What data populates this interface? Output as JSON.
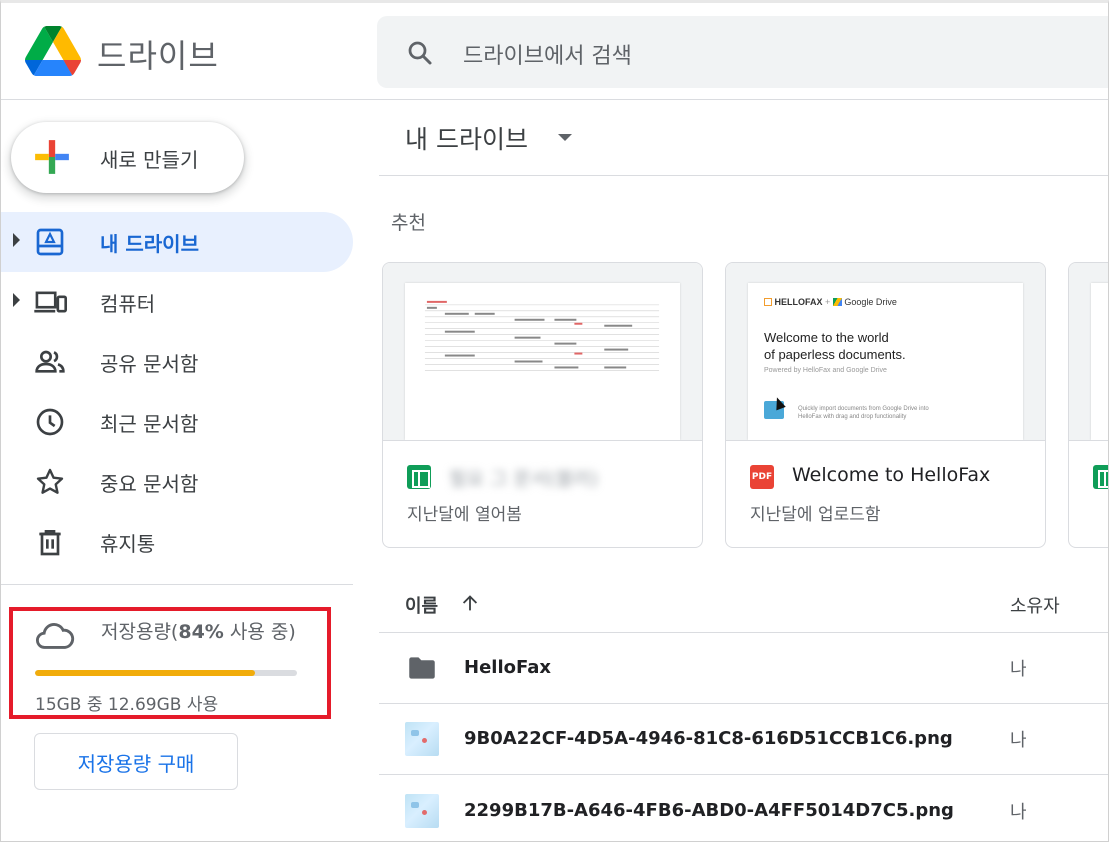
{
  "header": {
    "app_title": "드라이브",
    "search_placeholder": "드라이브에서 검색"
  },
  "sidebar": {
    "new_button": "새로 만들기",
    "items": [
      {
        "label": "내 드라이브",
        "icon": "my-drive-icon",
        "active": true,
        "expandable": true
      },
      {
        "label": "컴퓨터",
        "icon": "computers-icon",
        "active": false,
        "expandable": true
      },
      {
        "label": "공유 문서함",
        "icon": "shared-icon",
        "active": false,
        "expandable": false
      },
      {
        "label": "최근 문서함",
        "icon": "clock-icon",
        "active": false,
        "expandable": false
      },
      {
        "label": "중요 문서함",
        "icon": "star-icon",
        "active": false,
        "expandable": false
      },
      {
        "label": "휴지통",
        "icon": "trash-icon",
        "active": false,
        "expandable": false
      }
    ],
    "storage": {
      "label_prefix": "저장용량(",
      "percent_text": "84%",
      "label_suffix": " 사용 중)",
      "used_fraction": 0.84,
      "detail": "15GB 중 12.69GB 사용",
      "bar_color": "#f1ac0b",
      "highlight_color": "#e51b2a"
    },
    "buy_button": "저장용량 구매"
  },
  "main": {
    "title": "내 드라이브",
    "suggested_label": "추천",
    "cards": [
      {
        "name": "필요 그 문서(블러)",
        "sub": "지난달에 열어봄",
        "type": "sheet",
        "blurred": true
      },
      {
        "name": "Welcome to HelloFax",
        "sub": "지난달에 업로드함",
        "type": "pdf",
        "blurred": false
      }
    ],
    "hellofax_thumb": {
      "brand": "HELLOFAX",
      "plus": "+",
      "partner": "Google Drive",
      "headline_1": "Welcome to the world",
      "headline_2": "of paperless documents.",
      "powered": "Powered by HelloFax and Google Drive",
      "note_1": "Quickly import documents from Google Drive into",
      "note_2": "HelloFax with drag and drop functionality"
    },
    "list": {
      "col_name": "이름",
      "col_owner": "소유자",
      "rows": [
        {
          "name": "HelloFax",
          "owner": "나",
          "type": "folder"
        },
        {
          "name": "9B0A22CF-4D5A-4946-81C8-616D51CCB1C6.png",
          "owner": "나",
          "type": "image"
        },
        {
          "name": "2299B17B-A646-4FB6-ABD0-A4FF5014D7C5.png",
          "owner": "나",
          "type": "image"
        }
      ]
    }
  },
  "colors": {
    "accent": "#1967d2",
    "active_bg": "#e8f0fe"
  }
}
